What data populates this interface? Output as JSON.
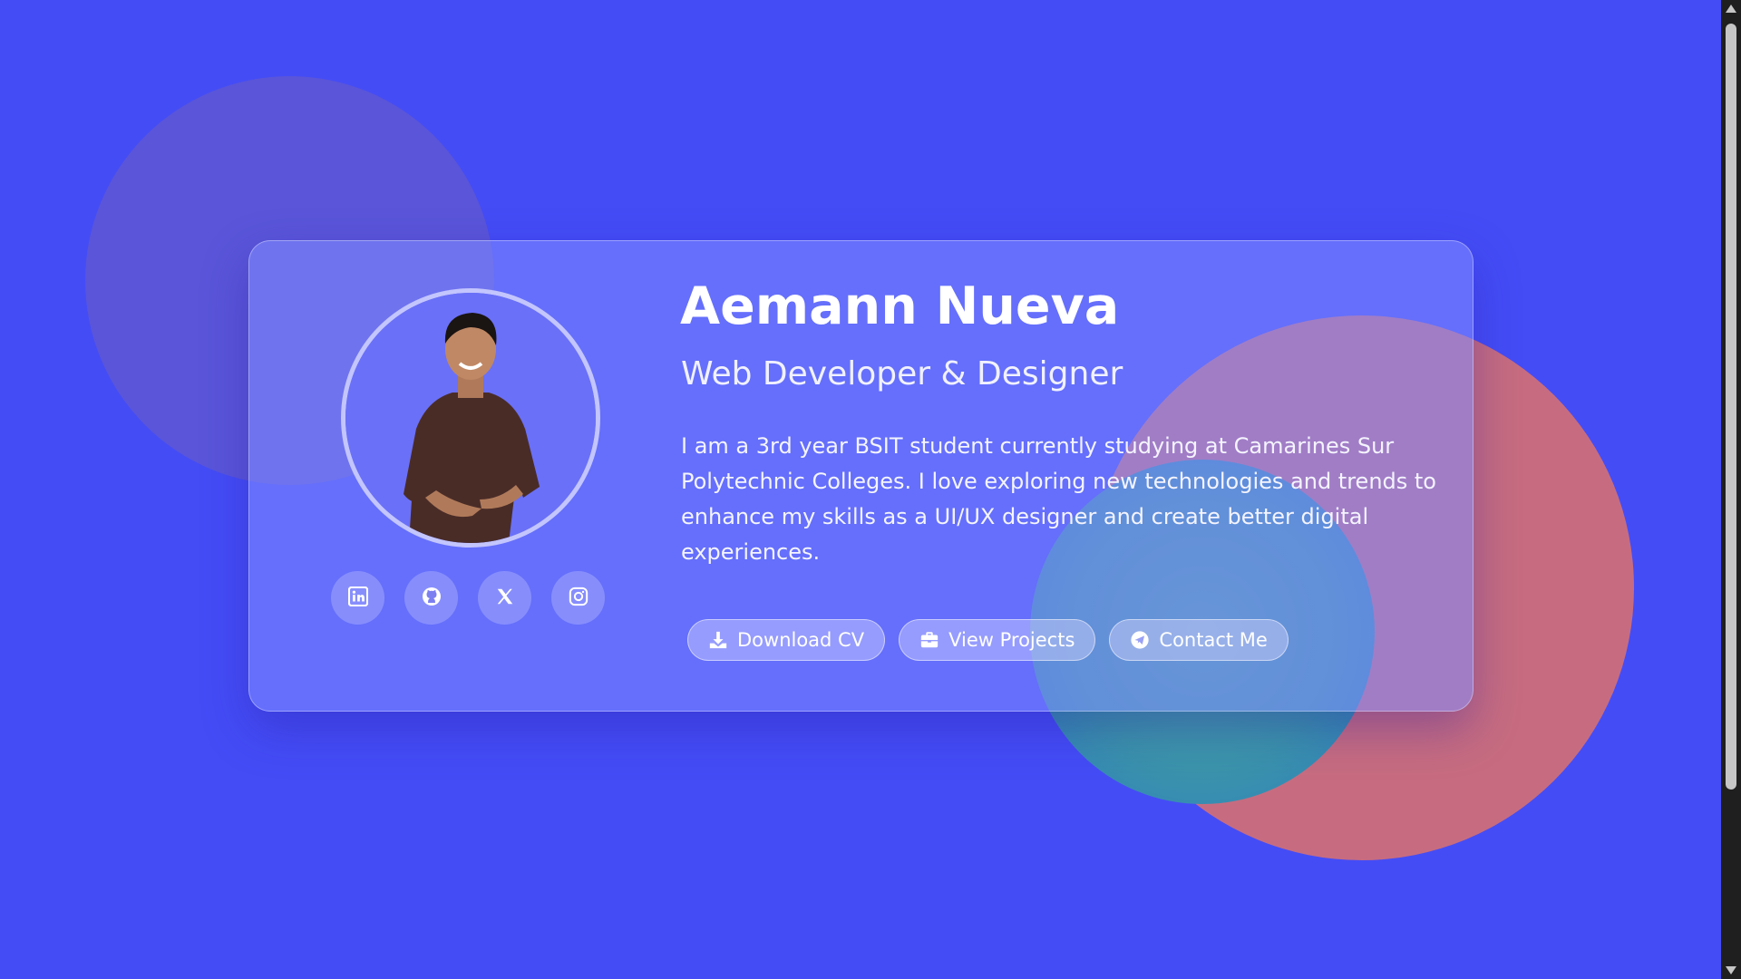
{
  "profile": {
    "name": "Aemann Nueva",
    "role": "Web Developer & Designer",
    "bio": "I am a 3rd year BSIT student currently studying at Camarines Sur Polytechnic Colleges. I love exploring new technologies and trends to enhance my skills as a UI/UX designer and create better digital experiences."
  },
  "socials": [
    {
      "icon": "linkedin-icon"
    },
    {
      "icon": "github-icon"
    },
    {
      "icon": "x-icon"
    },
    {
      "icon": "instagram-icon"
    }
  ],
  "actions": {
    "download_cv": "Download CV",
    "view_projects": "View Projects",
    "contact_me": "Contact Me"
  },
  "colors": {
    "background": "#444cf6",
    "blob_purple": "#5a55d9",
    "blob_red": "#c76c80",
    "blob_teal": "#3b94aa"
  }
}
